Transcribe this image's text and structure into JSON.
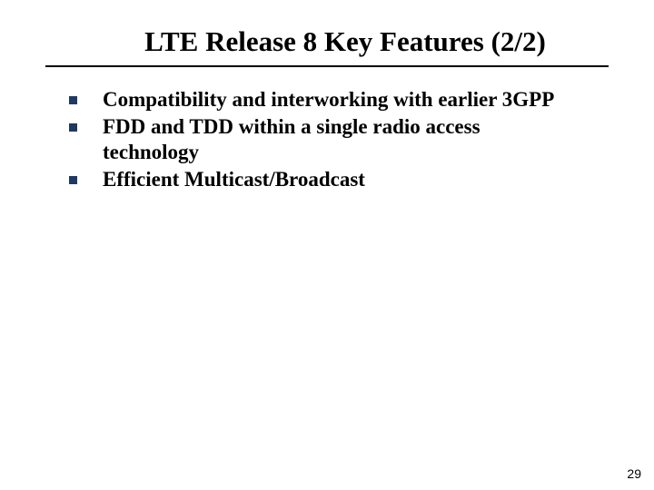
{
  "title": "LTE Release 8 Key Features (2/2)",
  "bullets": {
    "b0": "Compatibility and interworking with earlier 3GPP",
    "b1": "FDD and TDD within a single radio access technology",
    "b2": "Efficient Multicast/Broadcast"
  },
  "page_number": "29"
}
